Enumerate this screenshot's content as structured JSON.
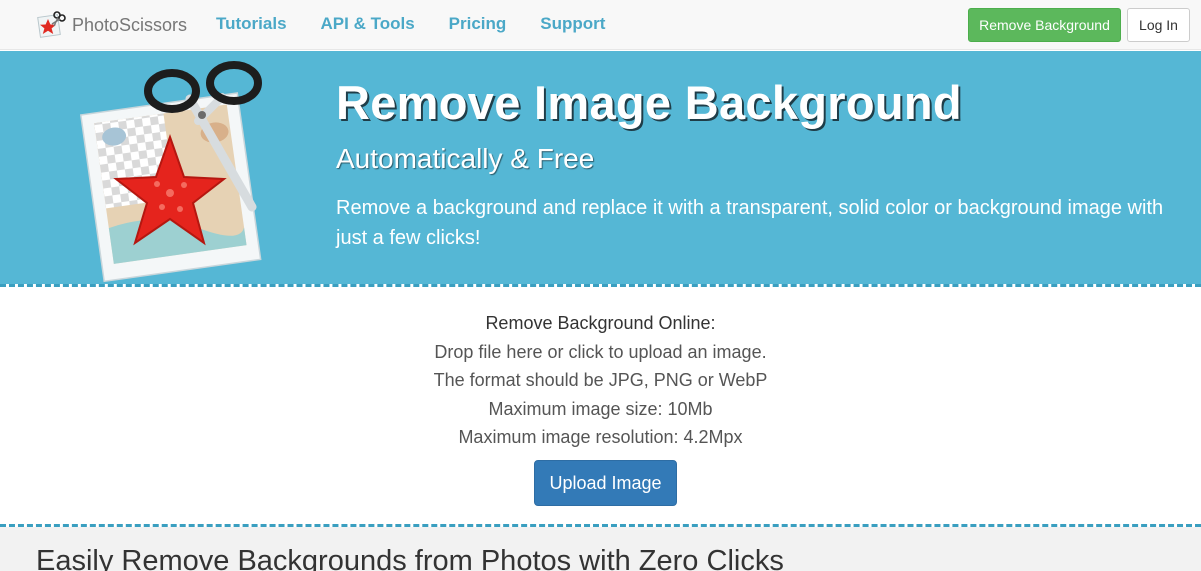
{
  "navbar": {
    "brand": "PhotoScissors",
    "links": [
      "Tutorials",
      "API & Tools",
      "Pricing",
      "Support"
    ],
    "remove_background_label": "Remove Background",
    "login_label": "Log In"
  },
  "hero": {
    "title": "Remove Image Background",
    "subtitle": "Automatically & Free",
    "description": "Remove a background and replace it with a transparent, solid color or background image with just a few clicks!"
  },
  "upload": {
    "heading": "Remove Background Online:",
    "lines": [
      "Drop file here or click to upload an image.",
      "The format should be JPG, PNG or WebP",
      "Maximum image size: 10Mb",
      "Maximum image resolution: 4.2Mpx"
    ],
    "button_label": "Upload Image"
  },
  "section": {
    "heading": "Easily Remove Backgrounds from Photos with Zero Clicks"
  },
  "colors": {
    "hero_bg": "#55b7d5",
    "nav_link": "#4ba8c7",
    "success": "#5cb85c",
    "primary": "#337ab7"
  },
  "icons": [
    "photoscissors-logo-icon",
    "scissors-starfish-hero-icon"
  ]
}
